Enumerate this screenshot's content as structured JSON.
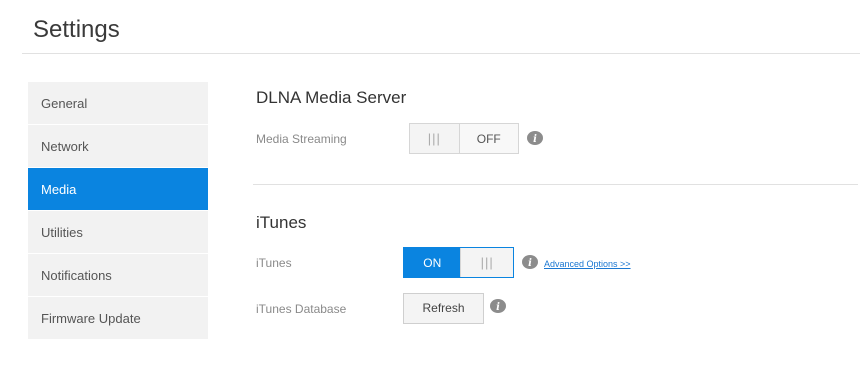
{
  "header": {
    "title": "Settings"
  },
  "sidebar": {
    "items": [
      {
        "label": "General"
      },
      {
        "label": "Network"
      },
      {
        "label": "Media"
      },
      {
        "label": "Utilities"
      },
      {
        "label": "Notifications"
      },
      {
        "label": "Firmware Update"
      }
    ],
    "active": "Media"
  },
  "dlna": {
    "title": "DLNA Media Server",
    "media_streaming": {
      "label": "Media Streaming",
      "state": "OFF",
      "grip": "|||"
    }
  },
  "itunes": {
    "title": "iTunes",
    "toggle": {
      "label": "iTunes",
      "state": "ON",
      "grip": "|||"
    },
    "advanced_link": "Advanced Options >>",
    "database": {
      "label": "iTunes Database",
      "button": "Refresh"
    }
  },
  "colors": {
    "accent": "#0a84e0",
    "sidebar_bg": "#f2f2f2",
    "link": "#1a77d2"
  }
}
